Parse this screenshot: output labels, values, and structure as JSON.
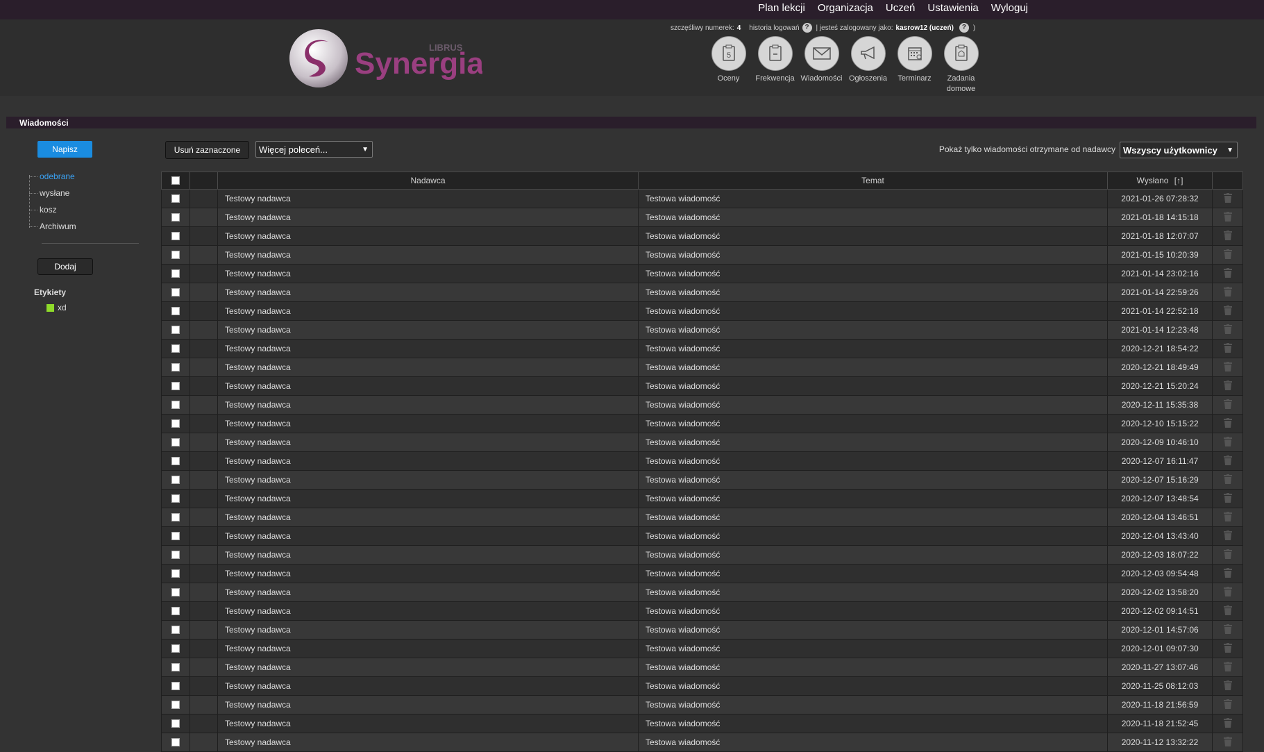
{
  "top_nav": {
    "links": [
      "Plan lekcji",
      "Organizacja",
      "Uczeń",
      "Ustawienia",
      "Wyloguj"
    ]
  },
  "header": {
    "logo_text": "Synergia",
    "logo_brand": "LIBRUS",
    "lucky_number_label": "szczęśliwy numerek:",
    "lucky_number": "4",
    "login_history_label": "historia logowań",
    "logged_in_label": "| jesteś zalogowany jako:",
    "logged_in_user": "kasrow12 (uczeń)",
    "logged_in_close": ")"
  },
  "modules": [
    {
      "label": "Oceny",
      "icon": "grades-icon"
    },
    {
      "label": "Frekwencja",
      "icon": "attendance-icon"
    },
    {
      "label": "Wiadomości",
      "icon": "messages-icon"
    },
    {
      "label": "Ogłoszenia",
      "icon": "announcements-icon"
    },
    {
      "label": "Terminarz",
      "icon": "calendar-icon"
    },
    {
      "label": "Zadania domowe",
      "icon": "homework-icon"
    }
  ],
  "page": {
    "title": "Wiadomości"
  },
  "sidebar": {
    "compose_label": "Napisz",
    "folders": [
      "odebrane",
      "wysłane",
      "kosz",
      "Archiwum"
    ],
    "add_label": "Dodaj",
    "labels_heading": "Etykiety",
    "label_name": "xd",
    "label_color": "#8fdb2a"
  },
  "toolbar": {
    "delete_selected_label": "Usuń zaznaczone",
    "more_commands_value": "Więcej poleceń...",
    "sender_filter_label": "Pokaż tylko wiadomości otrzymane od nadawcy",
    "sender_filter_value": "Wszyscy użytkownicy"
  },
  "table": {
    "columns": {
      "sender": "Nadawca",
      "subject": "Temat",
      "sent": "Wysłano",
      "sort_indicator": "[↑]"
    },
    "rows": [
      {
        "sender": "Testowy nadawca",
        "subject": "Testowa wiadomość",
        "date": "2021-01-26 07:28:32"
      },
      {
        "sender": "Testowy nadawca",
        "subject": "Testowa wiadomość",
        "date": "2021-01-18 14:15:18"
      },
      {
        "sender": "Testowy nadawca",
        "subject": "Testowa wiadomość",
        "date": "2021-01-18 12:07:07"
      },
      {
        "sender": "Testowy nadawca",
        "subject": "Testowa wiadomość",
        "date": "2021-01-15 10:20:39"
      },
      {
        "sender": "Testowy nadawca",
        "subject": "Testowa wiadomość",
        "date": "2021-01-14 23:02:16"
      },
      {
        "sender": "Testowy nadawca",
        "subject": "Testowa wiadomość",
        "date": "2021-01-14 22:59:26"
      },
      {
        "sender": "Testowy nadawca",
        "subject": "Testowa wiadomość",
        "date": "2021-01-14 22:52:18"
      },
      {
        "sender": "Testowy nadawca",
        "subject": "Testowa wiadomość",
        "date": "2021-01-14 12:23:48"
      },
      {
        "sender": "Testowy nadawca",
        "subject": "Testowa wiadomość",
        "date": "2020-12-21 18:54:22"
      },
      {
        "sender": "Testowy nadawca",
        "subject": "Testowa wiadomość",
        "date": "2020-12-21 18:49:49"
      },
      {
        "sender": "Testowy nadawca",
        "subject": "Testowa wiadomość",
        "date": "2020-12-21 15:20:24"
      },
      {
        "sender": "Testowy nadawca",
        "subject": "Testowa wiadomość",
        "date": "2020-12-11 15:35:38"
      },
      {
        "sender": "Testowy nadawca",
        "subject": "Testowa wiadomość",
        "date": "2020-12-10 15:15:22"
      },
      {
        "sender": "Testowy nadawca",
        "subject": "Testowa wiadomość",
        "date": "2020-12-09 10:46:10"
      },
      {
        "sender": "Testowy nadawca",
        "subject": "Testowa wiadomość",
        "date": "2020-12-07 16:11:47"
      },
      {
        "sender": "Testowy nadawca",
        "subject": "Testowa wiadomość",
        "date": "2020-12-07 15:16:29"
      },
      {
        "sender": "Testowy nadawca",
        "subject": "Testowa wiadomość",
        "date": "2020-12-07 13:48:54"
      },
      {
        "sender": "Testowy nadawca",
        "subject": "Testowa wiadomość",
        "date": "2020-12-04 13:46:51"
      },
      {
        "sender": "Testowy nadawca",
        "subject": "Testowa wiadomość",
        "date": "2020-12-04 13:43:40"
      },
      {
        "sender": "Testowy nadawca",
        "subject": "Testowa wiadomość",
        "date": "2020-12-03 18:07:22"
      },
      {
        "sender": "Testowy nadawca",
        "subject": "Testowa wiadomość",
        "date": "2020-12-03 09:54:48"
      },
      {
        "sender": "Testowy nadawca",
        "subject": "Testowa wiadomość",
        "date": "2020-12-02 13:58:20"
      },
      {
        "sender": "Testowy nadawca",
        "subject": "Testowa wiadomość",
        "date": "2020-12-02 09:14:51"
      },
      {
        "sender": "Testowy nadawca",
        "subject": "Testowa wiadomość",
        "date": "2020-12-01 14:57:06"
      },
      {
        "sender": "Testowy nadawca",
        "subject": "Testowa wiadomość",
        "date": "2020-12-01 09:07:30"
      },
      {
        "sender": "Testowy nadawca",
        "subject": "Testowa wiadomość",
        "date": "2020-11-27 13:07:46"
      },
      {
        "sender": "Testowy nadawca",
        "subject": "Testowa wiadomość",
        "date": "2020-11-25 08:12:03"
      },
      {
        "sender": "Testowy nadawca",
        "subject": "Testowa wiadomość",
        "date": "2020-11-18 21:56:59"
      },
      {
        "sender": "Testowy nadawca",
        "subject": "Testowa wiadomość",
        "date": "2020-11-18 21:52:45"
      },
      {
        "sender": "Testowy nadawca",
        "subject": "Testowa wiadomość",
        "date": "2020-11-12 13:32:22"
      }
    ]
  }
}
